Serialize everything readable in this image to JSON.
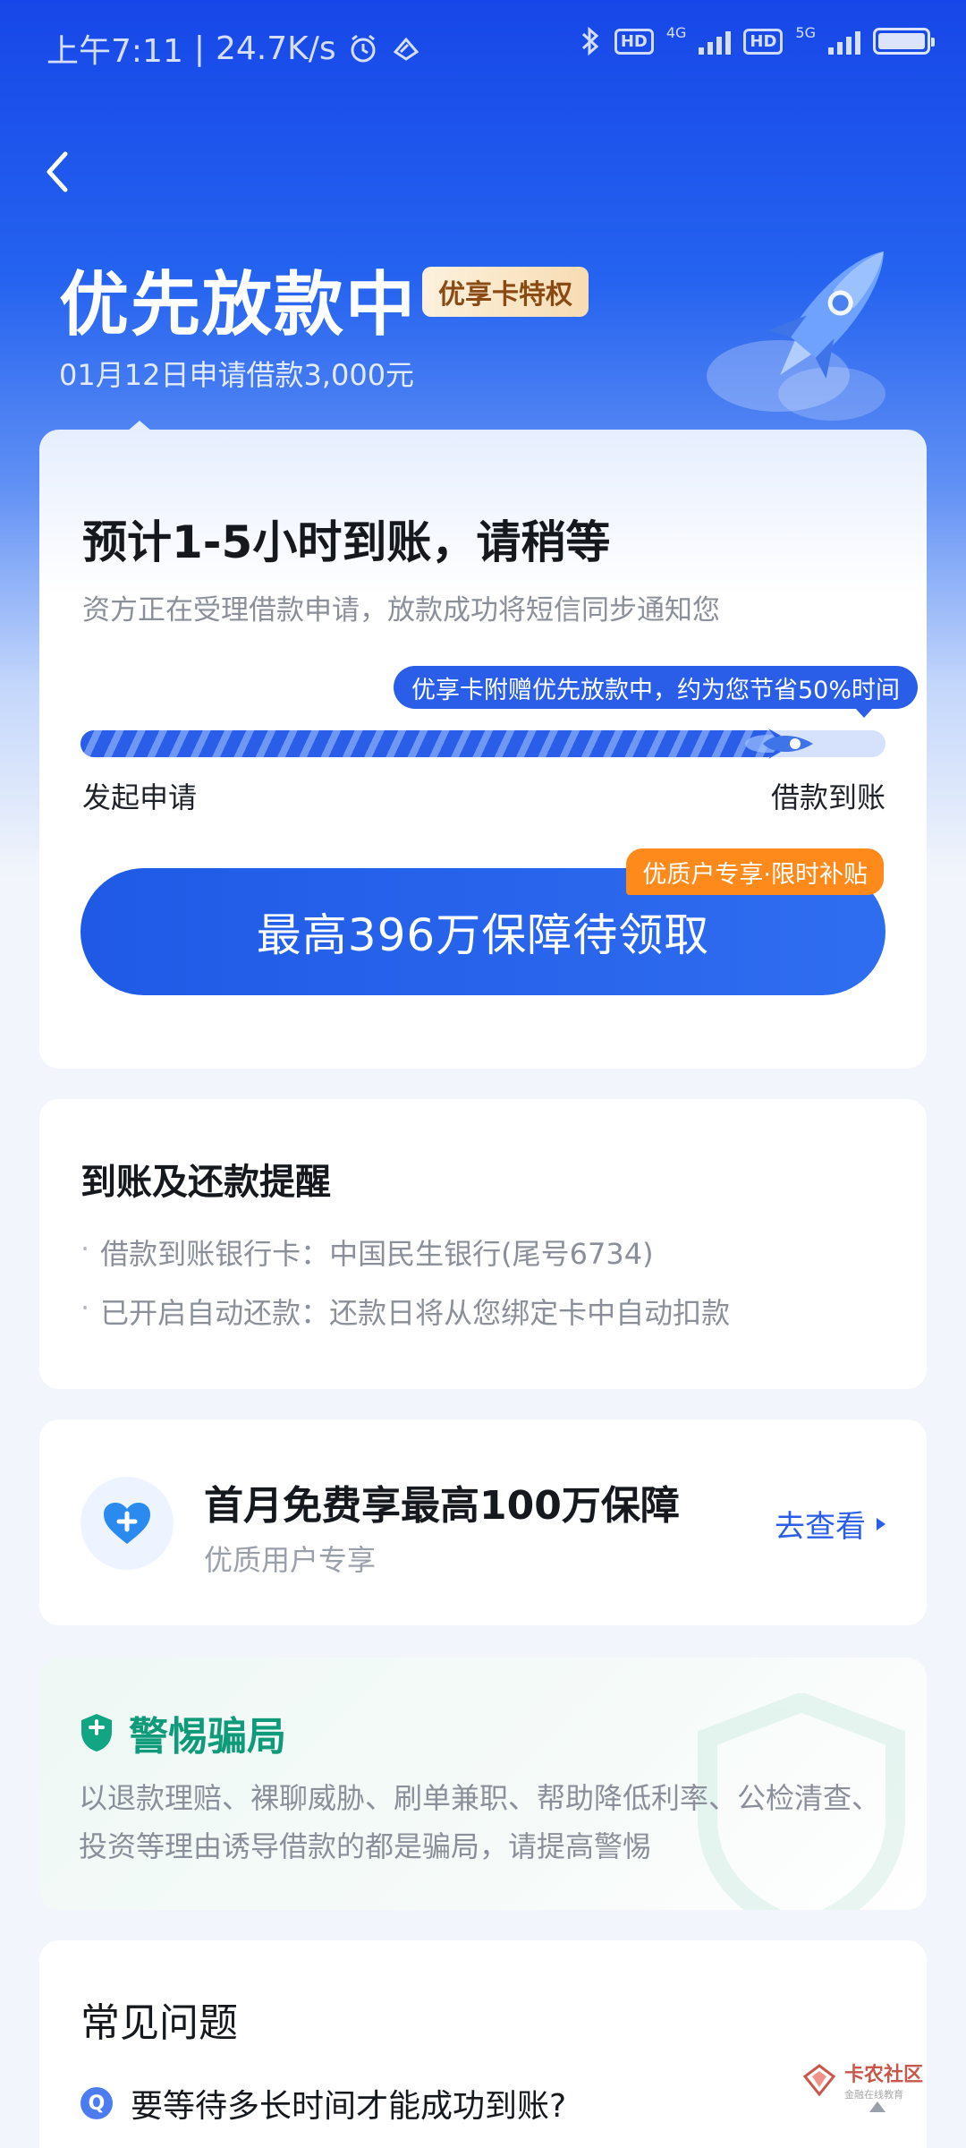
{
  "status_bar": {
    "time": "上午7:11",
    "net_speed": "24.7K/s",
    "hd1": "HD",
    "net1": "4G",
    "hd2": "HD",
    "net2": "5G"
  },
  "header": {
    "title": "优先放款中",
    "badge": "优享卡特权",
    "subtitle": "01月12日申请借款3,000元"
  },
  "progress_card": {
    "eta_title": "预计1-5小时到账，请稍等",
    "eta_desc": "资方正在受理借款申请，放款成功将短信同步通知您",
    "tip": "优享卡附赠优先放款中，约为您节省50%时间",
    "progress_fraction": 0.87,
    "start_label": "发起申请",
    "end_label": "借款到账",
    "promo_tag": "优质户专享·限时补贴",
    "cta_label": "最高396万保障待领取"
  },
  "reminder": {
    "title": "到账及还款提醒",
    "items": [
      "借款到账银行卡：中国民生银行(尾号6734)",
      "已开启自动还款：还款日将从您绑定卡中自动扣款"
    ]
  },
  "insurance": {
    "title": "首月免费享最高100万保障",
    "subtitle": "优质用户专享",
    "link": "去查看"
  },
  "warning": {
    "title": "警惕骗局",
    "text": "以退款理赔、裸聊威胁、刷单兼职、帮助降低利率、公检清查、投资等理由诱导借款的都是骗局，请提高警惕"
  },
  "faq": {
    "title": "常见问题",
    "q_badge": "Q",
    "question": "要等待多长时间才能成功到账?"
  },
  "watermark": {
    "main": "卡农社区",
    "sub": "金融在线教育"
  },
  "colors": {
    "primary": "#2a5ee8",
    "promo": "#ff8a1c",
    "warning": "#0f9b7a",
    "badge_text": "#8a4a14"
  }
}
